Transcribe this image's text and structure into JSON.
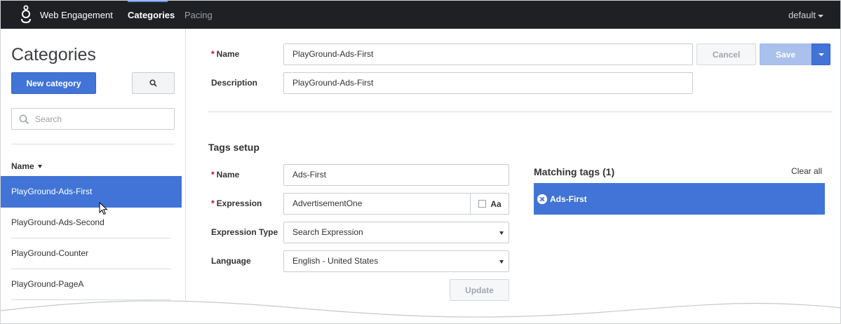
{
  "topbar": {
    "app_name": "Web Engagement",
    "nav": [
      {
        "label": "Categories",
        "active": true
      },
      {
        "label": "Pacing",
        "active": false
      }
    ],
    "user_menu": "default"
  },
  "sidebar": {
    "title": "Categories",
    "new_button": "New category",
    "search_placeholder": "Search",
    "column_header": "Name",
    "items": [
      {
        "label": "PlayGround-Ads-First",
        "selected": true
      },
      {
        "label": "PlayGround-Ads-Second",
        "selected": false
      },
      {
        "label": "PlayGround-Counter",
        "selected": false
      },
      {
        "label": "PlayGround-PageA",
        "selected": false
      }
    ]
  },
  "form": {
    "name_label": "Name",
    "name_value": "PlayGround-Ads-First",
    "description_label": "Description",
    "description_value": "PlayGround-Ads-First",
    "cancel_label": "Cancel",
    "save_label": "Save"
  },
  "tags_setup": {
    "title": "Tags setup",
    "name_label": "Name",
    "name_value": "Ads-First",
    "expression_label": "Expression",
    "expression_value": "AdvertisementOne",
    "case_toggle_label": "Aa",
    "expression_type_label": "Expression Type",
    "expression_type_value": "Search Expression",
    "language_label": "Language",
    "language_value": "English - United States",
    "update_label": "Update"
  },
  "matching_tags": {
    "title": "Matching tags (1)",
    "clear_all": "Clear all",
    "tags": [
      "Ads-First"
    ]
  },
  "colors": {
    "accent": "#4174d6",
    "topbar": "#1e2023",
    "required": "#d0021b"
  }
}
